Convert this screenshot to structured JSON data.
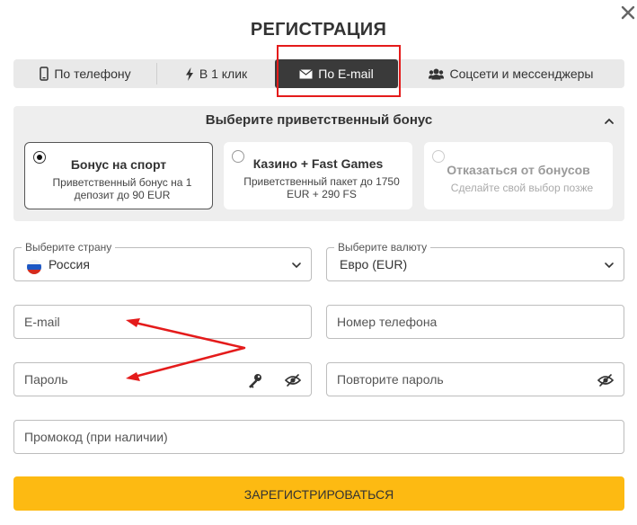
{
  "dialog": {
    "title": "РЕГИСТРАЦИЯ"
  },
  "tabs": [
    {
      "label": "По телефону",
      "icon": "phone-icon"
    },
    {
      "label": "В 1 клик",
      "icon": "lightning-icon"
    },
    {
      "label": "По E-mail",
      "icon": "envelope-icon",
      "active": true
    },
    {
      "label": "Соцсети и мессенджеры",
      "icon": "users-icon"
    }
  ],
  "bonus": {
    "title": "Выберите приветственный бонус",
    "options": [
      {
        "title": "Бонус на спорт",
        "subtitle": "Приветственный бонус на 1 депозит до 90 EUR",
        "selected": true
      },
      {
        "title": "Казино + Fast Games",
        "subtitle": "Приветственный пакет до 1750 EUR + 290 FS",
        "selected": false
      },
      {
        "title": "Отказаться от бонусов",
        "subtitle": "Сделайте свой выбор позже",
        "selected": false
      }
    ]
  },
  "form": {
    "country": {
      "label": "Выберите страну",
      "value": "Россия"
    },
    "currency": {
      "label": "Выберите валюту",
      "value": "Евро (EUR)"
    },
    "email": {
      "placeholder": "E-mail"
    },
    "phone": {
      "placeholder": "Номер телефона"
    },
    "password": {
      "placeholder": "Пароль"
    },
    "password_repeat": {
      "placeholder": "Повторите пароль"
    },
    "promo": {
      "placeholder": "Промокод (при наличии)"
    }
  },
  "submit": {
    "label": "ЗАРЕГИСТРИРОВАТЬСЯ"
  },
  "colors": {
    "accent": "#fdba12",
    "active_tab": "#3a3a3a",
    "highlight": "#e41b1b"
  }
}
